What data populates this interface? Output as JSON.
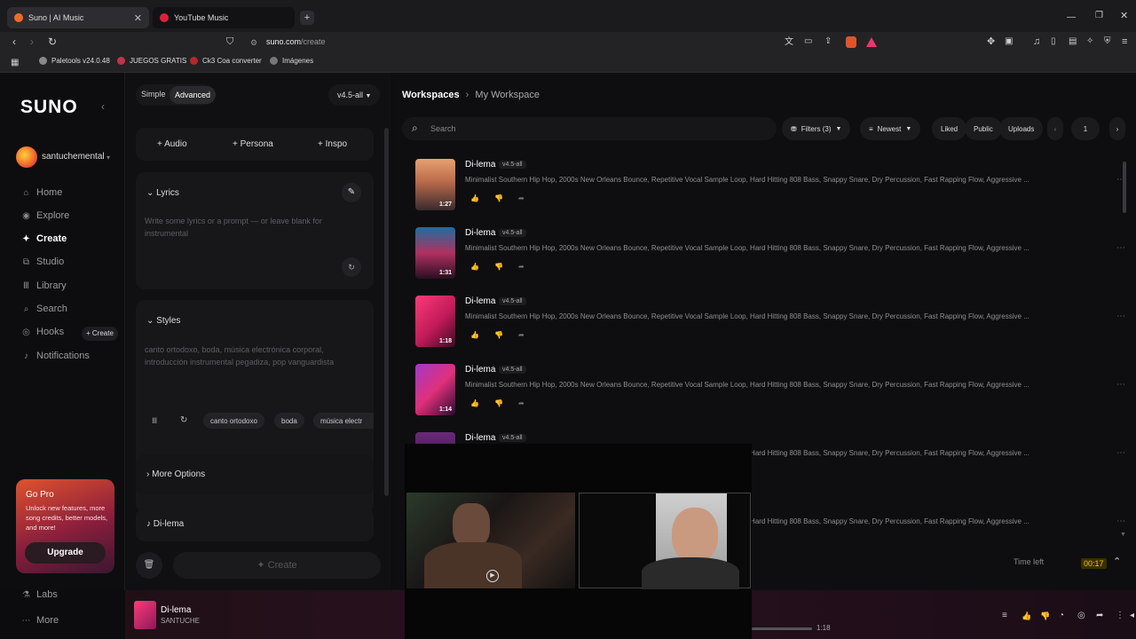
{
  "browser": {
    "tabs": [
      {
        "title": "Suno | AI Music"
      },
      {
        "title": "YouTube Music"
      }
    ],
    "url_host": "suno.com",
    "url_path": "/create",
    "bookmarks": [
      "Paletools v24.0.48",
      "JUEGOS GRATIS",
      "Ck3 Coa converter",
      "Imágenes"
    ]
  },
  "sidebar": {
    "logo": "SUNO",
    "user": "santuchemental",
    "nav": [
      {
        "label": "Home",
        "icon": "home-icon"
      },
      {
        "label": "Explore",
        "icon": "compass-icon"
      },
      {
        "label": "Create",
        "icon": "sparkle-icon"
      },
      {
        "label": "Studio",
        "icon": "studio-icon"
      },
      {
        "label": "Library",
        "icon": "library-icon"
      },
      {
        "label": "Search",
        "icon": "search-icon"
      },
      {
        "label": "Hooks",
        "icon": "hooks-icon"
      },
      {
        "label": "Notifications",
        "icon": "bell-icon"
      }
    ],
    "hooks_create": "+ Create",
    "gopro": {
      "title": "Go Pro",
      "text": "Unlock new features, more song credits, better models, and more!",
      "button": "Upgrade"
    },
    "labs": "Labs",
    "more": "More"
  },
  "form": {
    "mode_simple": "Simple",
    "mode_advanced": "Advanced",
    "model": "v4.5-all",
    "add_audio": "Audio",
    "add_persona": "Persona",
    "add_inspo": "Inspo",
    "lyrics_label": "Lyrics",
    "lyrics_placeholder": "Write some lyrics or a prompt — or leave blank for instrumental",
    "styles_label": "Styles",
    "styles_text": "canto ortodoxo, boda, música electrónica corporal, introducción instrumental pegadiza, pop vanguardista",
    "style_chips": [
      "canto ortodoxo",
      "boda",
      "música electr"
    ],
    "more_options": "More Options",
    "song_title": "Di-lema",
    "create_button": "Create"
  },
  "main": {
    "breadcrumb_root": "Workspaces",
    "breadcrumb_current": "My Workspace",
    "search_placeholder": "Search",
    "filters": "Filters (3)",
    "sort": "Newest",
    "liked": "Liked",
    "public": "Public",
    "uploads": "Uploads",
    "page": "1",
    "songs": [
      {
        "title": "Di-lema",
        "version": "v4.5-all",
        "duration": "1:27",
        "desc": "Minimalist Southern Hip Hop, 2000s New Orleans Bounce, Repetitive Vocal Sample Loop, Hard Hitting 808 Bass, Snappy Snare, Dry Percussion, Fast Rapping Flow, Aggressive ..."
      },
      {
        "title": "Di-lema",
        "version": "v4.5-all",
        "duration": "1:31",
        "desc": "Minimalist Southern Hip Hop, 2000s New Orleans Bounce, Repetitive Vocal Sample Loop, Hard Hitting 808 Bass, Snappy Snare, Dry Percussion, Fast Rapping Flow, Aggressive ..."
      },
      {
        "title": "Di-lema",
        "version": "v4.5-all",
        "duration": "1:18",
        "desc": "Minimalist Southern Hip Hop, 2000s New Orleans Bounce, Repetitive Vocal Sample Loop, Hard Hitting 808 Bass, Snappy Snare, Dry Percussion, Fast Rapping Flow, Aggressive ..."
      },
      {
        "title": "Di-lema",
        "version": "v4.5-all",
        "duration": "1:14",
        "desc": "Minimalist Southern Hip Hop, 2000s New Orleans Bounce, Repetitive Vocal Sample Loop, Hard Hitting 808 Bass, Snappy Snare, Dry Percussion, Fast Rapping Flow, Aggressive ..."
      },
      {
        "title": "Di-lema",
        "version": "v4.5-all",
        "duration": "",
        "desc": "Minimalist Southern Hip Hop, 2000s New Orleans Bounce, Repetitive Vocal Sample Loop, Hard Hitting 808 Bass, Snappy Snare, Dry Percussion, Fast Rapping Flow, Aggressive ..."
      },
      {
        "title": "",
        "version": "",
        "duration": "",
        "desc": "Minimalist Southern Hip Hop, 2000s New Orleans Bounce, Repetitive Vocal Sample Loop, Hard Hitting 808 Bass, Snappy Snare, Dry Percussion, Fast Rapping Flow, Aggressive ..."
      }
    ],
    "time_left_label": "Time left",
    "time_left_value": "00:17"
  },
  "player": {
    "title": "Di-lema",
    "artist": "SANTUCHE",
    "time": "1:18"
  },
  "colors": {
    "accent": "#ff2d6e",
    "gopro_grad": "#e0522c",
    "timeleft": "#f2c200"
  }
}
